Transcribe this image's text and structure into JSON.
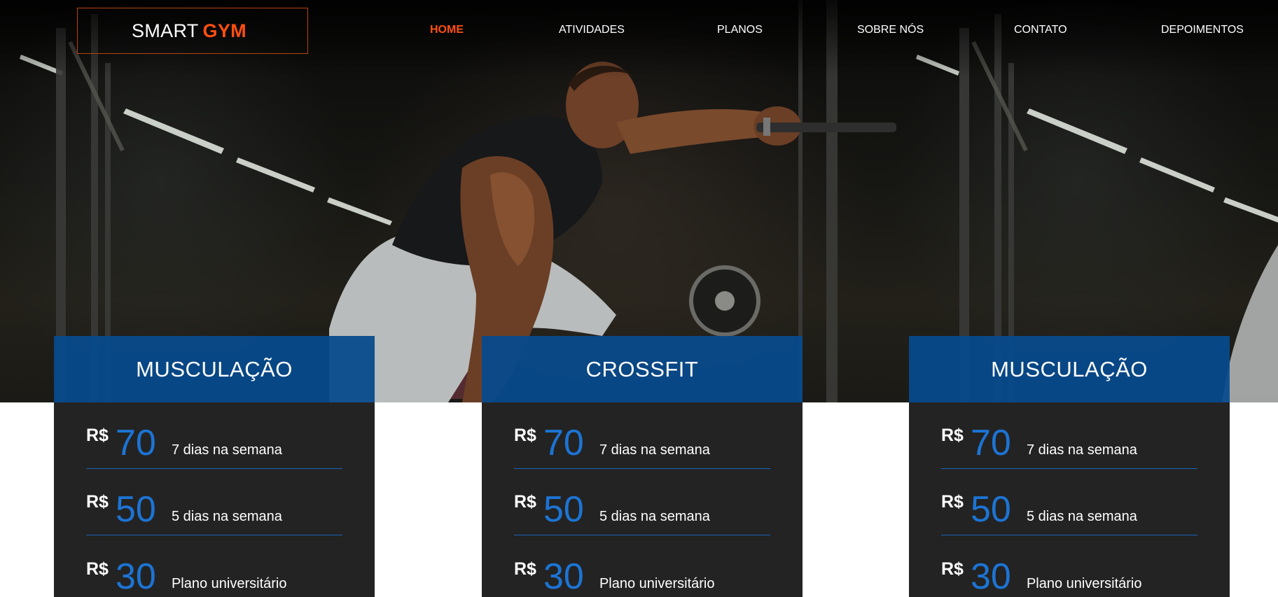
{
  "brand": {
    "name": "SMART",
    "accent": "GYM",
    "accent_color": "#ff4f10"
  },
  "nav": {
    "items": [
      {
        "label": "HOME",
        "active": true
      },
      {
        "label": "ATIVIDADES",
        "active": false
      },
      {
        "label": "PLANOS",
        "active": false
      },
      {
        "label": "SOBRE NÓS",
        "active": false
      },
      {
        "label": "CONTATO",
        "active": false
      },
      {
        "label": "DEPOIMENTOS",
        "active": false
      }
    ]
  },
  "hero": {
    "image": "gym-athlete-photo"
  },
  "plans": [
    {
      "title": "MUSCULAÇÃO",
      "prices": [
        {
          "currency": "R$",
          "amount": "70",
          "desc": "7 dias na semana"
        },
        {
          "currency": "R$",
          "amount": "50",
          "desc": "5 dias na semana"
        },
        {
          "currency": "R$",
          "amount": "30",
          "desc": "Plano universitário"
        }
      ]
    },
    {
      "title": "CROSSFIT",
      "prices": [
        {
          "currency": "R$",
          "amount": "70",
          "desc": "7 dias na semana"
        },
        {
          "currency": "R$",
          "amount": "50",
          "desc": "5 dias na semana"
        },
        {
          "currency": "R$",
          "amount": "30",
          "desc": "Plano universitário"
        }
      ]
    },
    {
      "title": "MUSCULAÇÃO",
      "prices": [
        {
          "currency": "R$",
          "amount": "70",
          "desc": "7 dias na semana"
        },
        {
          "currency": "R$",
          "amount": "50",
          "desc": "5 dias na semana"
        },
        {
          "currency": "R$",
          "amount": "30",
          "desc": "Plano universitário"
        }
      ]
    }
  ],
  "colors": {
    "primary_blue": "#074a8c",
    "price_blue": "#1c74d4",
    "card_dark": "#232323",
    "nav_active": "#ff4f10"
  }
}
